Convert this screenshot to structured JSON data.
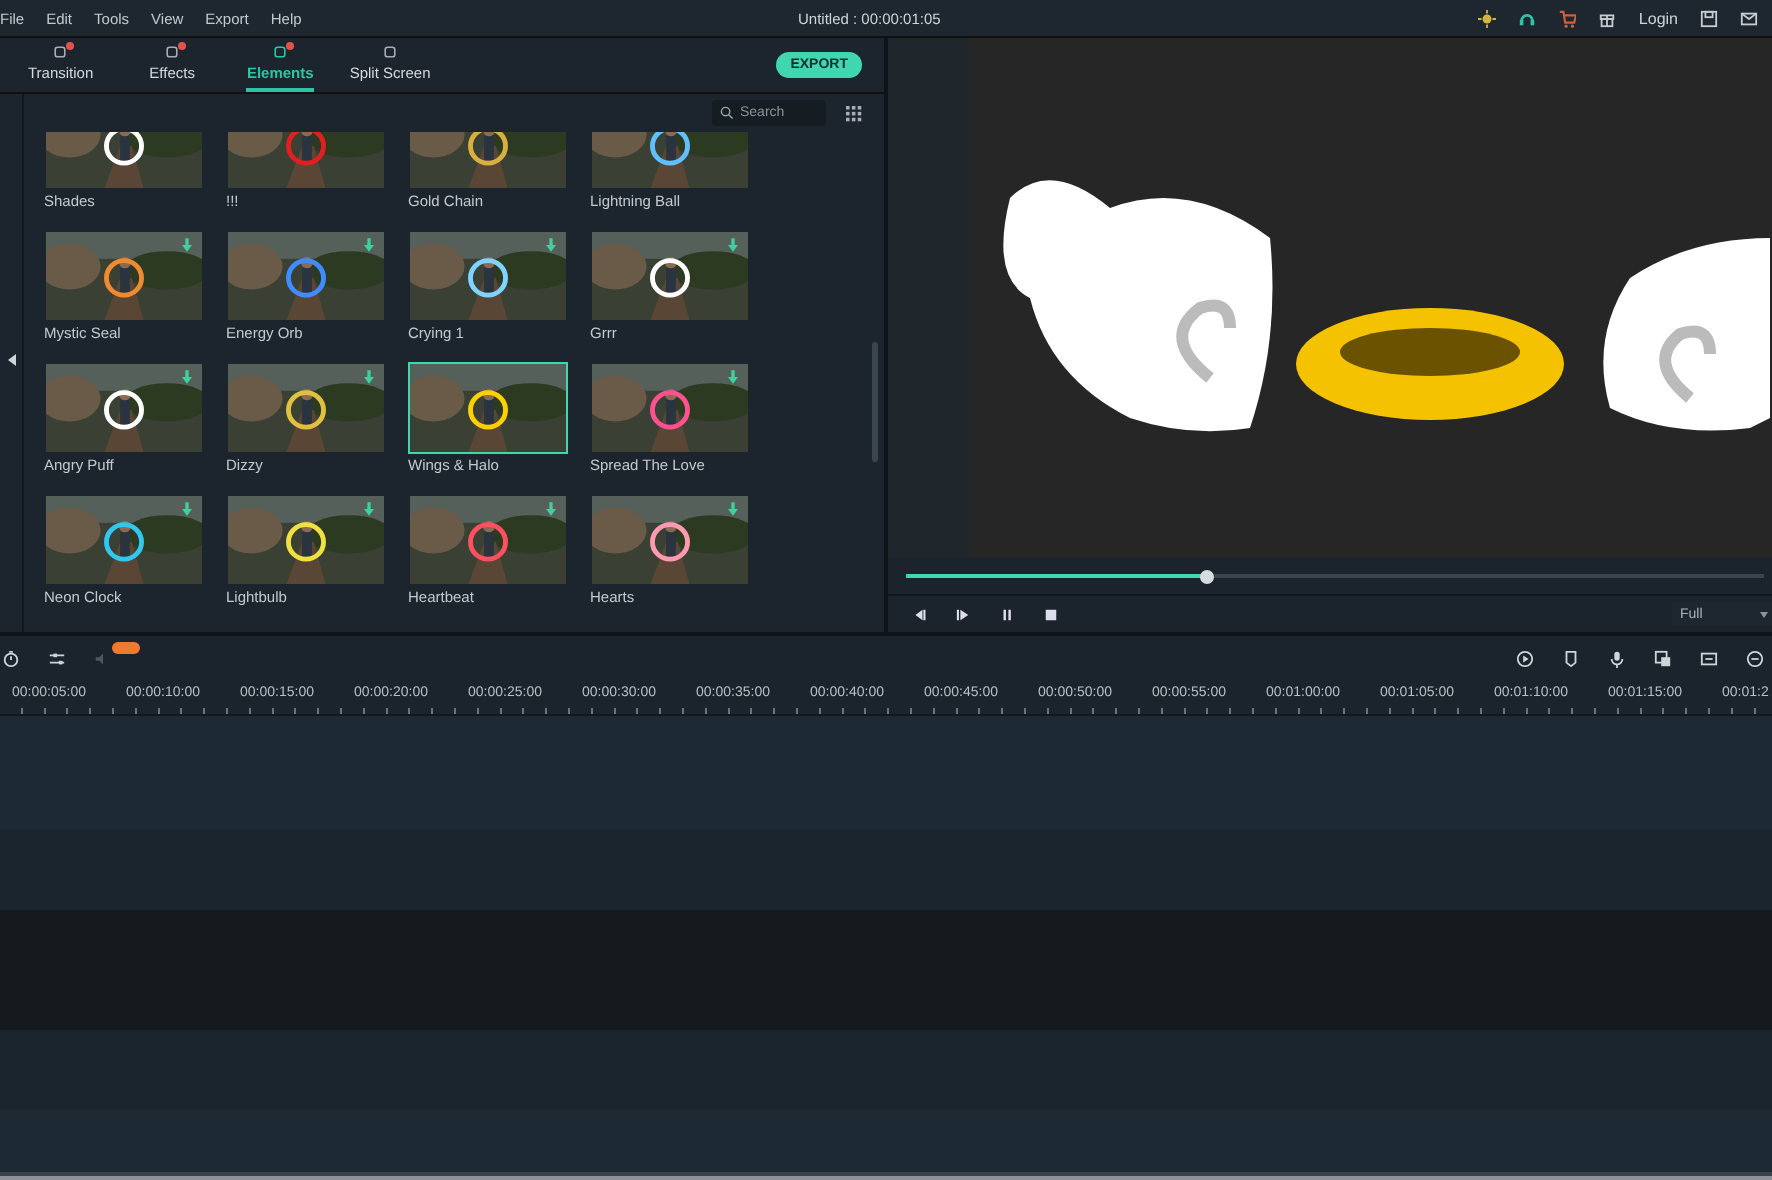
{
  "menu": [
    "File",
    "Edit",
    "Tools",
    "View",
    "Export",
    "Help"
  ],
  "title": "Untitled : 00:00:01:05",
  "login": "Login",
  "tabs": [
    {
      "label": "Transition",
      "selected": false,
      "notification": true
    },
    {
      "label": "Effects",
      "selected": false,
      "notification": true
    },
    {
      "label": "Elements",
      "selected": true,
      "notification": true
    },
    {
      "label": "Split Screen",
      "selected": false,
      "notification": false
    }
  ],
  "export_button": "EXPORT",
  "search": {
    "placeholder": "Search"
  },
  "elements": [
    {
      "name": "Shades",
      "selected": false,
      "download": false
    },
    {
      "name": "!!!",
      "selected": false,
      "download": false
    },
    {
      "name": "Gold Chain",
      "selected": false,
      "download": false
    },
    {
      "name": "Lightning Ball",
      "selected": false,
      "download": false
    },
    {
      "name": "Mystic Seal",
      "selected": false,
      "download": true
    },
    {
      "name": "Energy Orb",
      "selected": false,
      "download": true
    },
    {
      "name": "Crying 1",
      "selected": false,
      "download": true
    },
    {
      "name": "Grrr",
      "selected": false,
      "download": true
    },
    {
      "name": "Angry Puff",
      "selected": false,
      "download": true
    },
    {
      "name": "Dizzy",
      "selected": false,
      "download": true
    },
    {
      "name": "Wings & Halo",
      "selected": true,
      "download": false
    },
    {
      "name": "Spread The Love",
      "selected": false,
      "download": true
    },
    {
      "name": "Neon Clock",
      "selected": false,
      "download": true
    },
    {
      "name": "Lightbulb",
      "selected": false,
      "download": true
    },
    {
      "name": "Heartbeat",
      "selected": false,
      "download": true
    },
    {
      "name": "Hearts",
      "selected": false,
      "download": true
    }
  ],
  "player": {
    "level": 0.35,
    "quality": "Full"
  },
  "ruler": [
    "00:00:05:00",
    "00:00:10:00",
    "00:00:15:00",
    "00:00:20:00",
    "00:00:25:00",
    "00:00:30:00",
    "00:00:35:00",
    "00:00:40:00",
    "00:00:45:00",
    "00:00:50:00",
    "00:00:55:00",
    "00:01:00:00",
    "00:01:05:00",
    "00:01:10:00",
    "00:01:15:00",
    "00:01:2"
  ]
}
